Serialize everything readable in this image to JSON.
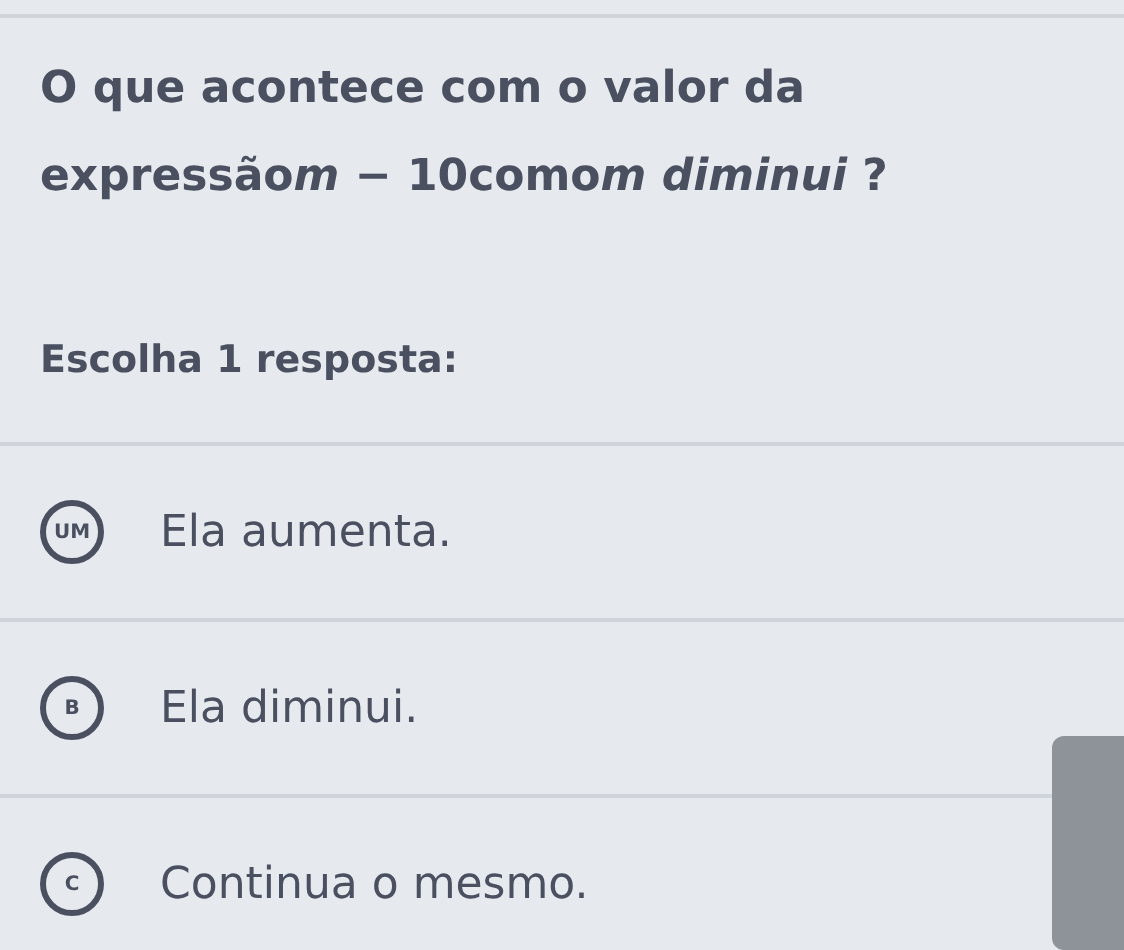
{
  "question": [
    {
      "text": "O que acontece com o valor da expressão",
      "italic": false
    },
    {
      "text": "m",
      "italic": true
    },
    {
      "text": " − 10como",
      "italic": false
    },
    {
      "text": "m diminui",
      "italic": true
    },
    {
      "text": " ?",
      "italic": false
    }
  ],
  "instruction": "Escolha 1 resposta:",
  "options": [
    {
      "letter": "UM",
      "text": "Ela aumenta."
    },
    {
      "letter": "B",
      "text": "Ela diminui."
    },
    {
      "letter": "C",
      "text": "Continua o mesmo."
    }
  ]
}
